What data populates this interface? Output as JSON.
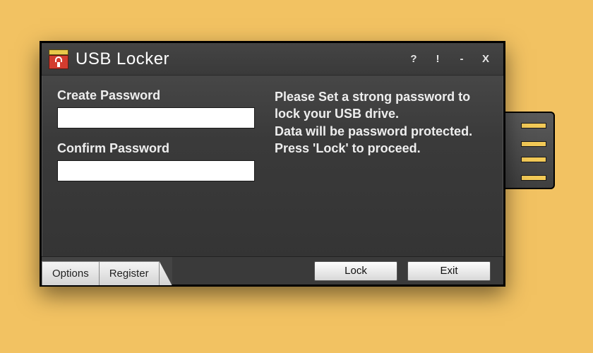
{
  "colors": {
    "background": "#f2c262",
    "icon_body": "#d33c2f",
    "usb_pin": "#f2c957"
  },
  "titlebar": {
    "title": "USB Locker",
    "help_symbol": "?",
    "minimize_symbol": "!",
    "spacer_symbol": "-",
    "close_symbol": "X"
  },
  "form": {
    "create_label": "Create Password",
    "create_value": "",
    "confirm_label": "Confirm Password",
    "confirm_value": ""
  },
  "instructions": {
    "line1": "Please Set a strong password to lock your USB drive.",
    "line2": "Data will be password protected.",
    "line3": "Press 'Lock' to proceed."
  },
  "footer": {
    "tab_options": "Options",
    "tab_register": "Register",
    "lock_label": "Lock",
    "exit_label": "Exit"
  }
}
